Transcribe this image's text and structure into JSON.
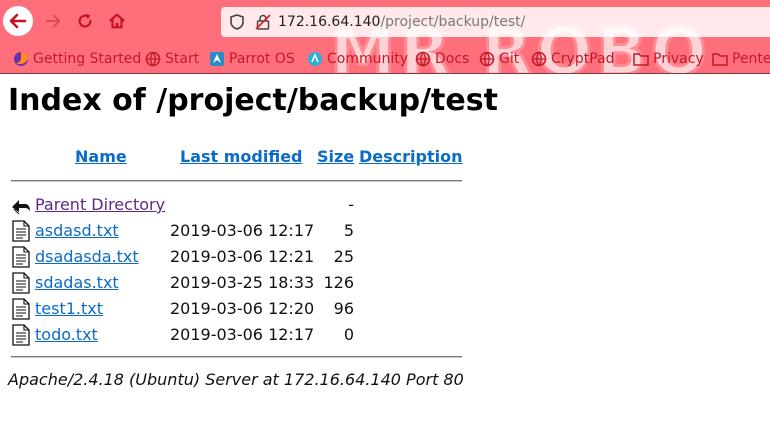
{
  "browser": {
    "url_host": "172.16.64.140",
    "url_path": "/project/backup/test/",
    "banner_text": "MR ROBO",
    "bookmarks": [
      {
        "label": "Getting Started",
        "icon": "firefox-icon"
      },
      {
        "label": "Start",
        "icon": "globe-icon"
      },
      {
        "label": "Parrot OS",
        "icon": "parrot-icon"
      },
      {
        "label": "Community",
        "icon": "community-icon"
      },
      {
        "label": "Docs",
        "icon": "globe-icon"
      },
      {
        "label": "Git",
        "icon": "globe-icon"
      },
      {
        "label": "CryptPad",
        "icon": "globe-icon"
      },
      {
        "label": "Privacy",
        "icon": "folder-icon"
      },
      {
        "label": "Pente",
        "icon": "folder-icon"
      }
    ],
    "colors": {
      "chrome": "#ff6f7b",
      "bookmark_text": "#c21a2a"
    }
  },
  "page": {
    "title": "Index of /project/backup/test",
    "columns": {
      "name": "Name",
      "modified": "Last modified",
      "size": "Size",
      "description": "Description"
    },
    "parent": {
      "label": "Parent Directory",
      "size": "-"
    },
    "files": [
      {
        "name": "asdasd.txt",
        "modified": "2019-03-06 12:17",
        "size": "5"
      },
      {
        "name": "dsadasda.txt",
        "modified": "2019-03-06 12:21",
        "size": "25"
      },
      {
        "name": "sdadas.txt",
        "modified": "2019-03-25 18:33",
        "size": "126"
      },
      {
        "name": "test1.txt",
        "modified": "2019-03-06 12:20",
        "size": "96"
      },
      {
        "name": "todo.txt",
        "modified": "2019-03-06 12:17",
        "size": "0"
      }
    ],
    "footer": "Apache/2.4.18 (Ubuntu) Server at 172.16.64.140 Port 80",
    "colors": {
      "link": "#0b6bc8",
      "visited": "#5b2a86"
    }
  }
}
